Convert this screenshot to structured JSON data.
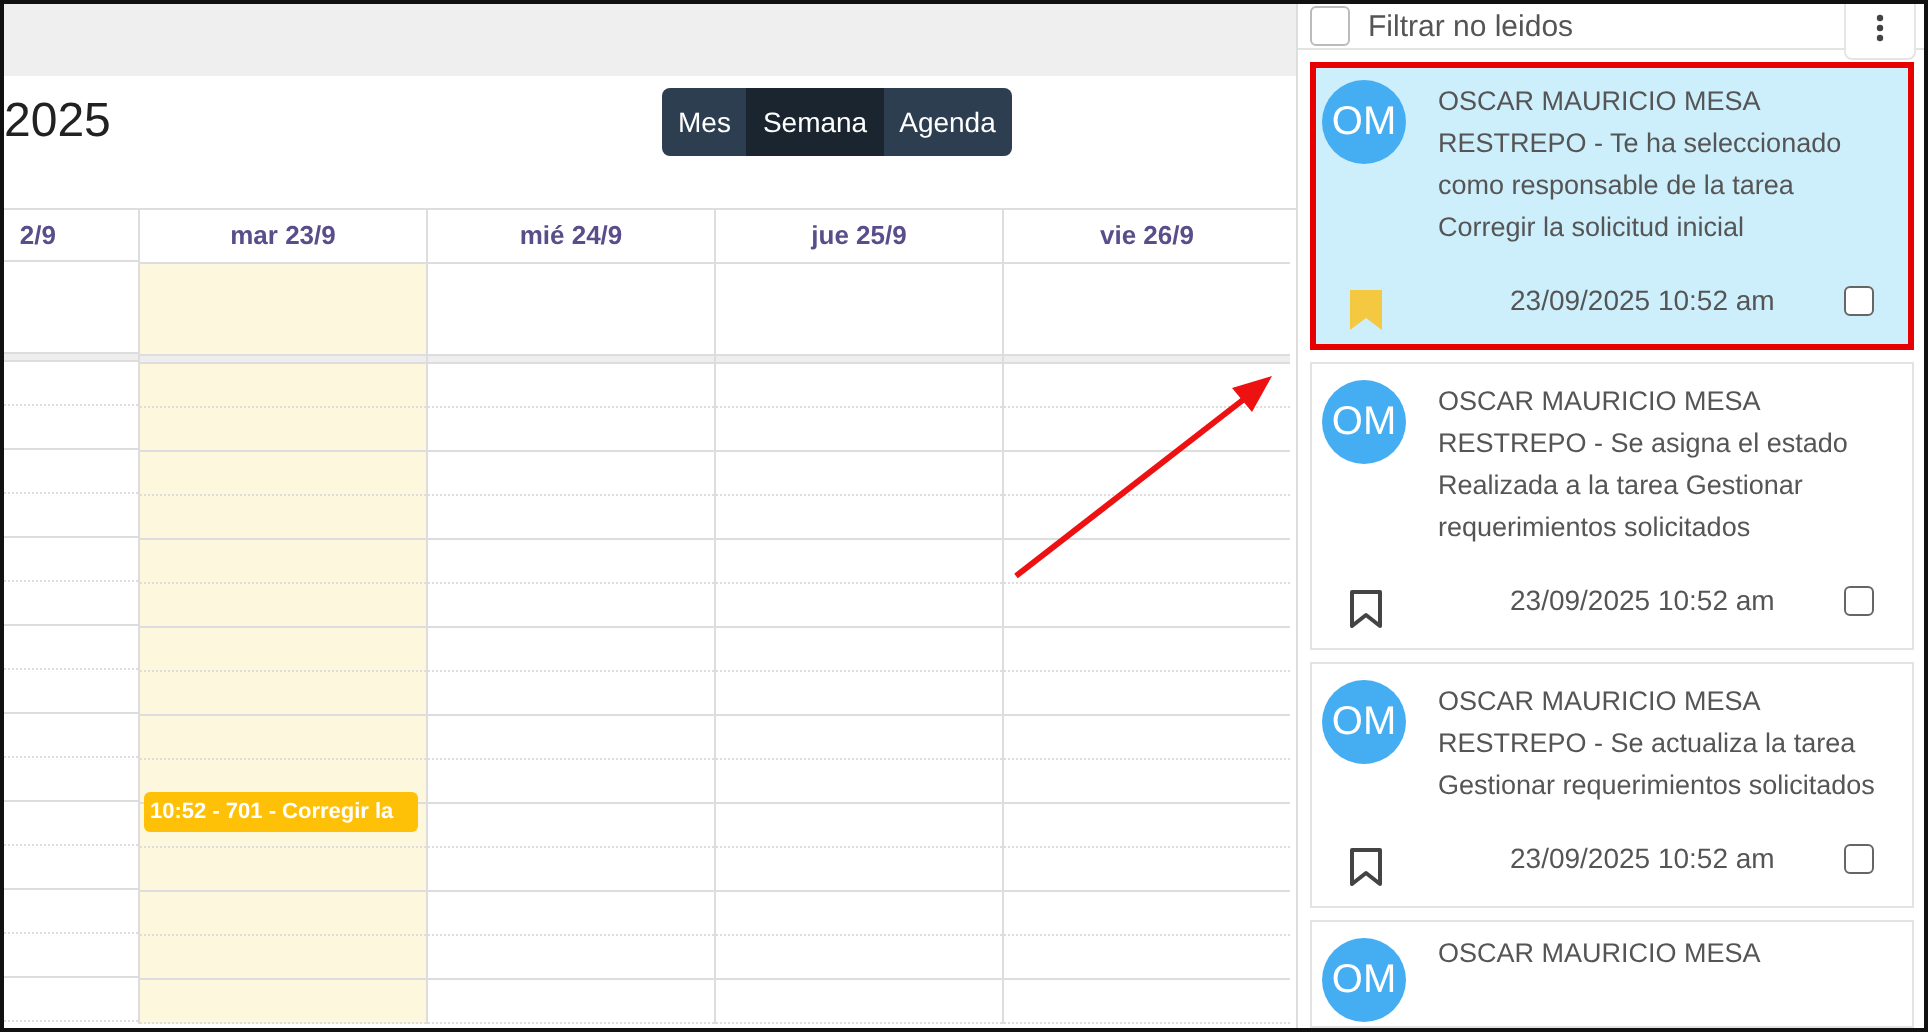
{
  "calendar": {
    "title": "2025",
    "views": [
      {
        "label": "Mes",
        "selected": false
      },
      {
        "label": "Semana",
        "selected": true
      },
      {
        "label": "Agenda",
        "selected": false
      }
    ],
    "days": [
      {
        "label": "2/9",
        "today": false
      },
      {
        "label": "mar 23/9",
        "today": true,
        "events": [
          {
            "label": "10:52 - 701 - Corregir la"
          }
        ]
      },
      {
        "label": "mié 24/9",
        "today": false
      },
      {
        "label": "jue 25/9",
        "today": false
      },
      {
        "label": "vie 26/9",
        "today": false
      }
    ]
  },
  "notifications": {
    "filter": {
      "label": "Filtrar no leidos",
      "checked": false
    },
    "items": [
      {
        "initials": "OM",
        "text": "OSCAR MAURICIO MESA RESTREPO - Te ha seleccionado como responsable de la tarea Corregir la solicitud inicial",
        "time": "23/09/2025 10:52 am",
        "bookmarked": true,
        "checked": false,
        "selected": true
      },
      {
        "initials": "OM",
        "text": "OSCAR MAURICIO MESA RESTREPO - Se asigna el estado Realizada a la tarea Gestionar requerimientos solicitados",
        "time": "23/09/2025 10:52 am",
        "bookmarked": false,
        "checked": false,
        "selected": false
      },
      {
        "initials": "OM",
        "text": "OSCAR MAURICIO MESA RESTREPO - Se actualiza la tarea Gestionar requerimientos solicitados",
        "time": "23/09/2025 10:52 am",
        "bookmarked": false,
        "checked": false,
        "selected": false
      },
      {
        "initials": "OM",
        "text": "OSCAR MAURICIO MESA"
      }
    ]
  }
}
